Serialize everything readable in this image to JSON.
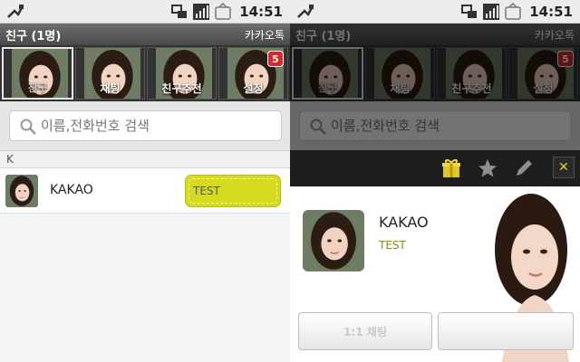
{
  "status_bar": {
    "time": "14:51",
    "icons": [
      "usb-icon",
      "network-sync-icon",
      "signal-icon",
      "battery-icon"
    ]
  },
  "title_bar": {
    "title": "친구 (1명)",
    "brand": "카카오톡"
  },
  "tabs": [
    {
      "label": "친구",
      "active": true
    },
    {
      "label": "채팅",
      "active": false
    },
    {
      "label": "친구추천",
      "active": false
    },
    {
      "label": "설정",
      "active": false,
      "badge": "5"
    }
  ],
  "search": {
    "placeholder": "이름,전화번호 검색"
  },
  "section_header": "K",
  "friend": {
    "name": "KAKAO",
    "status": "TEST"
  },
  "profile": {
    "name": "KAKAO",
    "status": "TEST",
    "buttons": {
      "chat": "1:1 채팅",
      "call": ""
    },
    "actions": [
      "gift-icon",
      "star-icon",
      "pencil-icon",
      "close-icon"
    ]
  },
  "colors": {
    "accent": "#d6da1e",
    "badge": "#d42a2a",
    "tab_bg": "#333333"
  }
}
